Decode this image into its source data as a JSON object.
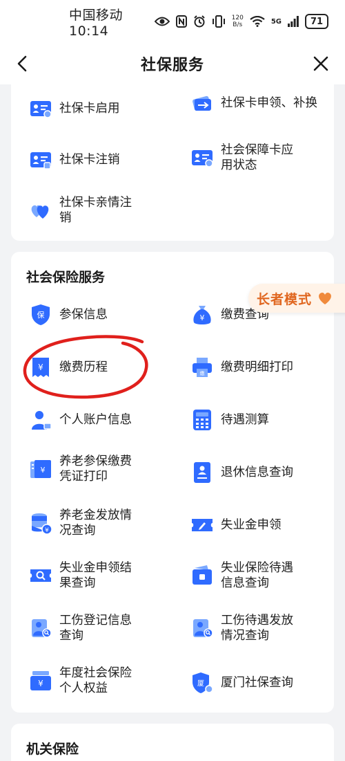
{
  "status_bar": {
    "carrier": "中国移动",
    "time": "10:14",
    "speed_value": "120",
    "speed_unit": "B/s",
    "network": "5G",
    "battery": "71"
  },
  "nav": {
    "title": "社保服务",
    "back_icon": "chevron-left-icon",
    "close_icon": "close-icon"
  },
  "card1": {
    "items": [
      {
        "label": "社保卡启用",
        "icon": "id-card-icon"
      },
      {
        "label": "社保卡申领、补换",
        "icon": "card-swap-icon"
      },
      {
        "label": "社保卡注销",
        "icon": "id-card-icon"
      },
      {
        "label": "社会保障卡应用状态",
        "icon": "id-card-icon"
      },
      {
        "label": "社保卡亲情注销",
        "icon": "hearts-icon"
      }
    ]
  },
  "card2": {
    "title": "社会保险服务",
    "items": [
      {
        "label": "参保信息",
        "icon": "shield-icon"
      },
      {
        "label": "缴费查询",
        "icon": "money-bag-icon"
      },
      {
        "label": "缴费历程",
        "icon": "receipt-yuan-icon"
      },
      {
        "label": "缴费明细打印",
        "icon": "printer-icon"
      },
      {
        "label": "个人账户信息",
        "icon": "person-icon"
      },
      {
        "label": "待遇测算",
        "icon": "calculator-icon"
      },
      {
        "label": "养老参保缴费凭证打印",
        "icon": "voucher-icon"
      },
      {
        "label": "退休信息查询",
        "icon": "document-person-icon"
      },
      {
        "label": "养老金发放情况查询",
        "icon": "coins-icon"
      },
      {
        "label": "失业金申领",
        "icon": "ticket-pen-icon"
      },
      {
        "label": "失业金申领结果查询",
        "icon": "ticket-search-icon"
      },
      {
        "label": "失业保险待遇信息查询",
        "icon": "wallet-icon"
      },
      {
        "label": "工伤登记信息查询",
        "icon": "injury-search-icon"
      },
      {
        "label": "工伤待遇发放情况查询",
        "icon": "injury-search-icon"
      },
      {
        "label": "年度社会保险个人权益",
        "icon": "yuan-folder-icon"
      },
      {
        "label": "厦门社保查询",
        "icon": "xiamen-shield-icon"
      }
    ]
  },
  "card3": {
    "title": "机关保险"
  },
  "elder_mode": {
    "label": "长者模式",
    "icon": "heart-icon"
  },
  "colors": {
    "primary_blue": "#2f6bff",
    "light_blue": "#7aa8ff",
    "accent_orange": "#e0661f",
    "annotation_red": "#e0201c"
  }
}
